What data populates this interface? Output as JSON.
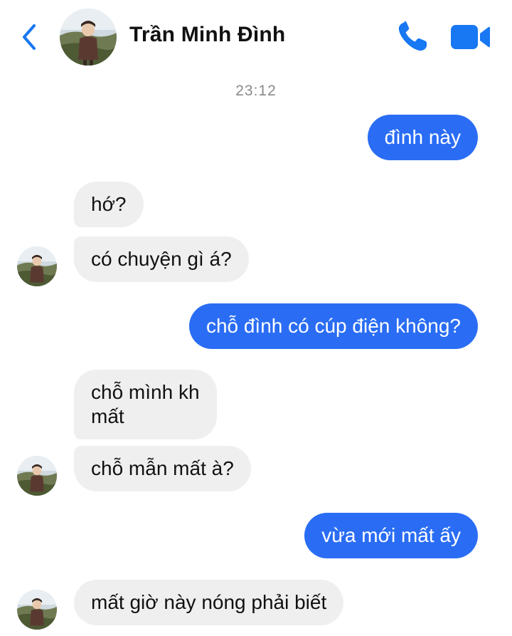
{
  "header": {
    "contact_name": "Trần Minh Đình",
    "back_icon": "chevron-left-icon",
    "call_icon": "phone-icon",
    "video_icon": "video-camera-icon",
    "accent": "#1877f2"
  },
  "timestamp": "23:12",
  "messages": [
    {
      "direction": "sent",
      "text": "đình này"
    },
    {
      "direction": "received",
      "text": "hớ?"
    },
    {
      "direction": "received",
      "text": "có chuyện gì á?"
    },
    {
      "direction": "sent",
      "text": "chỗ đình có cúp điện không?"
    },
    {
      "direction": "received",
      "lines": [
        "chỗ mình kh",
        "mất"
      ]
    },
    {
      "direction": "received",
      "text": "chỗ mẫn mất à?"
    },
    {
      "direction": "sent",
      "text": "vừa mới mất ấy"
    },
    {
      "direction": "received",
      "text": "mất giờ này nóng phải biết"
    }
  ],
  "colors": {
    "sent_bubble": "#2a6df4",
    "received_bubble": "#efefef"
  }
}
